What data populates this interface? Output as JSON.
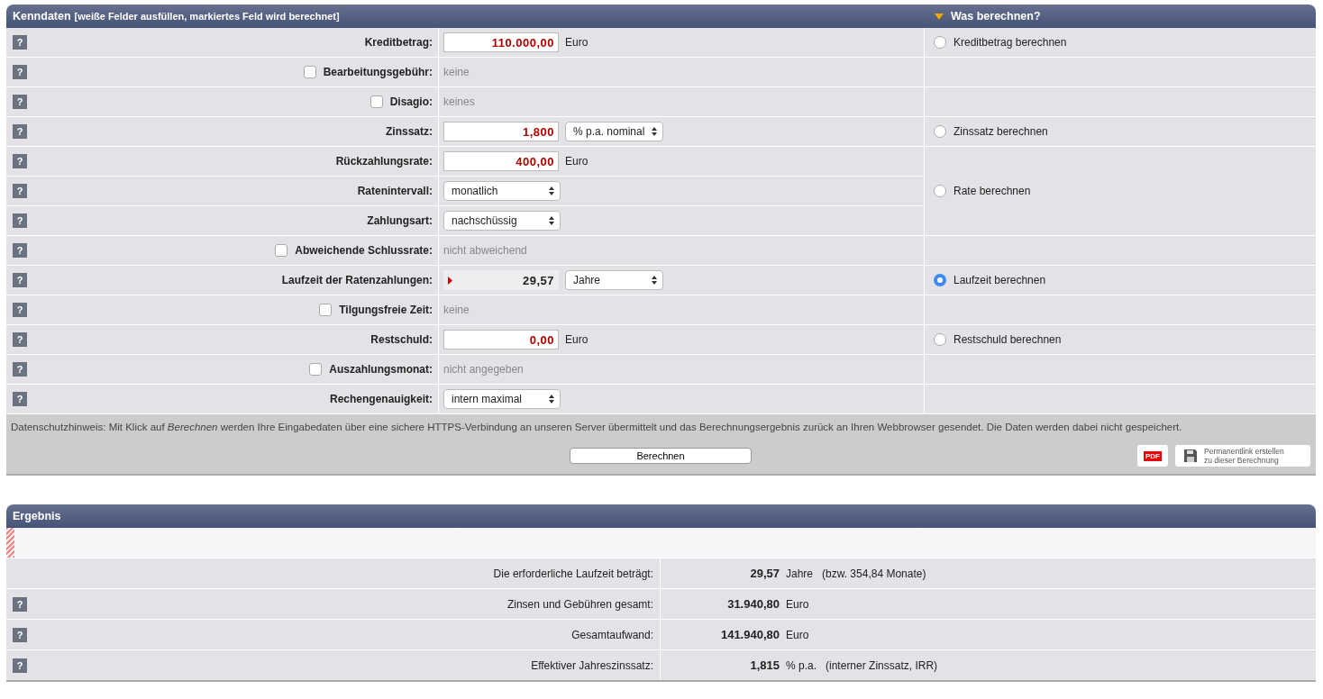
{
  "form": {
    "title": "Kenndaten",
    "subtitle": "[weiße Felder ausfüllen, markiertes Feld wird berechnet]",
    "side_title": "Was berechnen?",
    "groups": [
      {
        "calc": {
          "label": "Kreditbetrag berechnen",
          "selected": false
        },
        "rows": [
          {
            "help": "?",
            "label": "Kreditbetrag:",
            "kind": "input",
            "value": "110.000,00",
            "unit": "Euro"
          }
        ]
      },
      {
        "rows": [
          {
            "help": "?",
            "label": "Bearbeitungsgebühr:",
            "kind": "checkbox",
            "checked": false,
            "value": "keine"
          }
        ]
      },
      {
        "rows": [
          {
            "help": "?",
            "label": "Disagio:",
            "kind": "checkbox",
            "checked": false,
            "value": "keines"
          }
        ]
      },
      {
        "calc": {
          "label": "Zinssatz berechnen",
          "selected": false
        },
        "rows": [
          {
            "help": "?",
            "label": "Zinssatz:",
            "kind": "input_select",
            "value": "1,800",
            "select": "% p.a. nominal"
          }
        ]
      },
      {
        "calc": {
          "label": "Rate berechnen",
          "selected": false
        },
        "rows": [
          {
            "help": "?",
            "label": "Rückzahlungsrate:",
            "kind": "input",
            "value": "400,00",
            "unit": "Euro"
          },
          {
            "help": "?",
            "label": "Ratenintervall:",
            "kind": "select",
            "select": "monatlich"
          },
          {
            "help": "?",
            "label": "Zahlungsart:",
            "kind": "select",
            "select": "nachschüssig"
          }
        ]
      },
      {
        "rows": [
          {
            "help": "?",
            "label": "Abweichende Schlussrate:",
            "kind": "checkbox",
            "checked": false,
            "value": "nicht abweichend"
          }
        ]
      },
      {
        "calc": {
          "label": "Laufzeit berechnen",
          "selected": true
        },
        "rows": [
          {
            "help": "?",
            "label": "Laufzeit der Ratenzahlungen:",
            "kind": "computed",
            "value": "29,57",
            "select": "Jahre"
          }
        ]
      },
      {
        "rows": [
          {
            "help": "?",
            "label": "Tilgungsfreie Zeit:",
            "kind": "checkbox",
            "checked": false,
            "value": "keine"
          }
        ]
      },
      {
        "calc": {
          "label": "Restschuld berechnen",
          "selected": false
        },
        "rows": [
          {
            "help": "?",
            "label": "Restschuld:",
            "kind": "input",
            "value": "0,00",
            "unit": "Euro"
          }
        ]
      },
      {
        "rows": [
          {
            "help": "?",
            "label": "Auszahlungsmonat:",
            "kind": "checkbox",
            "checked": false,
            "value": "nicht angegeben"
          }
        ]
      },
      {
        "rows": [
          {
            "help": "?",
            "label": "Rechengenauigkeit:",
            "kind": "select",
            "select": "intern maximal"
          }
        ]
      }
    ],
    "notice": "Datenschutzhinweis: Mit Klick auf *Berechnen* werden Ihre Eingabedaten über eine sichere HTTPS-Verbindung an unseren Server übermittelt und das Berechnungsergebnis zurück an Ihren Webbrowser gesendet. Die Daten werden dabei nicht gespeichert.",
    "calculate_button": "Berechnen",
    "pdf_button": "PDF",
    "permalink_button": [
      "Permanentlink erstellen",
      "zu dieser Berechnung"
    ]
  },
  "result": {
    "title": "Ergebnis",
    "rows": [
      {
        "label": "Die erforderliche Laufzeit beträgt:",
        "value": "29,57",
        "unit": "Jahre",
        "note": "(bzw. 354,84 Monate)"
      },
      {
        "help": "?",
        "label": "Zinsen und Gebühren gesamt:",
        "value": "31.940,80",
        "unit": "Euro"
      },
      {
        "help": "?",
        "label": "Gesamtaufwand:",
        "value": "141.940,80",
        "unit": "Euro"
      },
      {
        "help": "?",
        "label": "Effektiver Jahreszinssatz:",
        "value": "1,815",
        "unit": "% p.a.",
        "note": "(interner Zinssatz, IRR)"
      }
    ]
  }
}
